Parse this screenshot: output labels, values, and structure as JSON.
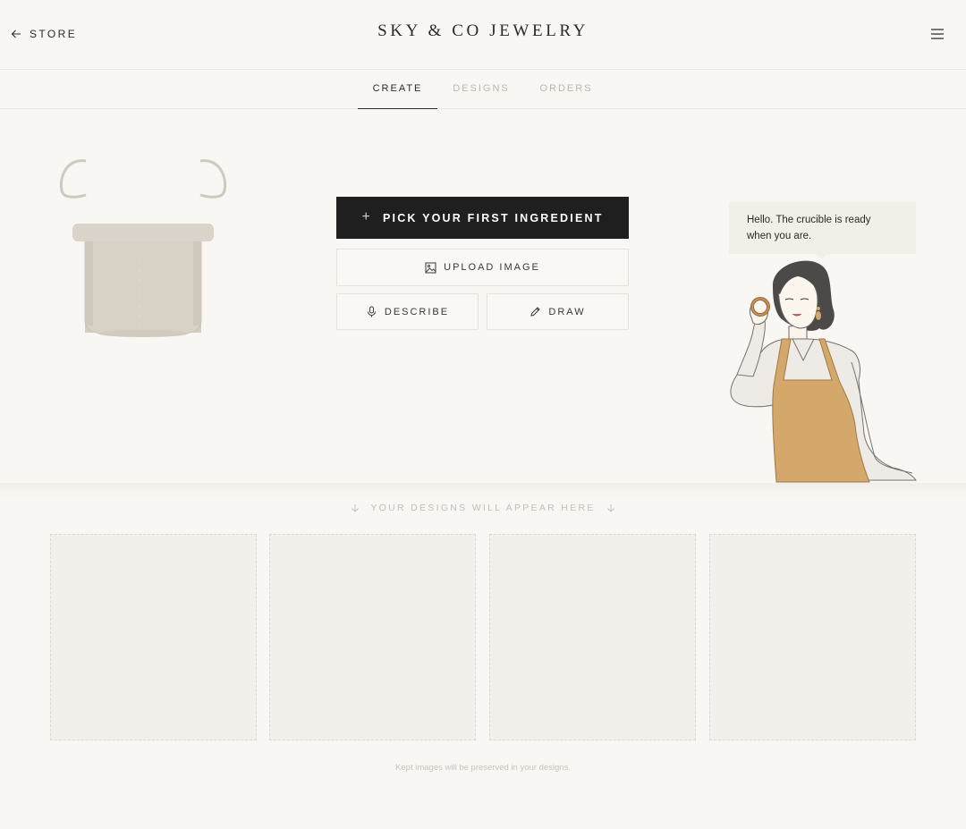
{
  "header": {
    "back_label": "STORE",
    "brand": "SKY & CO JEWELRY",
    "back_icon": "arrow-left-icon",
    "menu_icon": "hamburger-menu-icon"
  },
  "tabs": [
    {
      "label": "CREATE",
      "active": true
    },
    {
      "label": "DESIGNS",
      "active": false
    },
    {
      "label": "ORDERS",
      "active": false
    }
  ],
  "actions": {
    "primary_label": "PICK YOUR FIRST INGREDIENT",
    "upload_label": "UPLOAD IMAGE",
    "describe_label": "DESCRIBE",
    "draw_label": "DRAW"
  },
  "assistant": {
    "message": "Hello. The crucible is ready when you are."
  },
  "designs": {
    "caption": "YOUR DESIGNS WILL APPEAR HERE",
    "footnote": "Kept images will be preserved in your designs."
  },
  "colors": {
    "background": "#f9f7f3",
    "primary_button": "#1f1f1f",
    "apron": "#d4a76a",
    "crucible": "#d8d2c8"
  }
}
